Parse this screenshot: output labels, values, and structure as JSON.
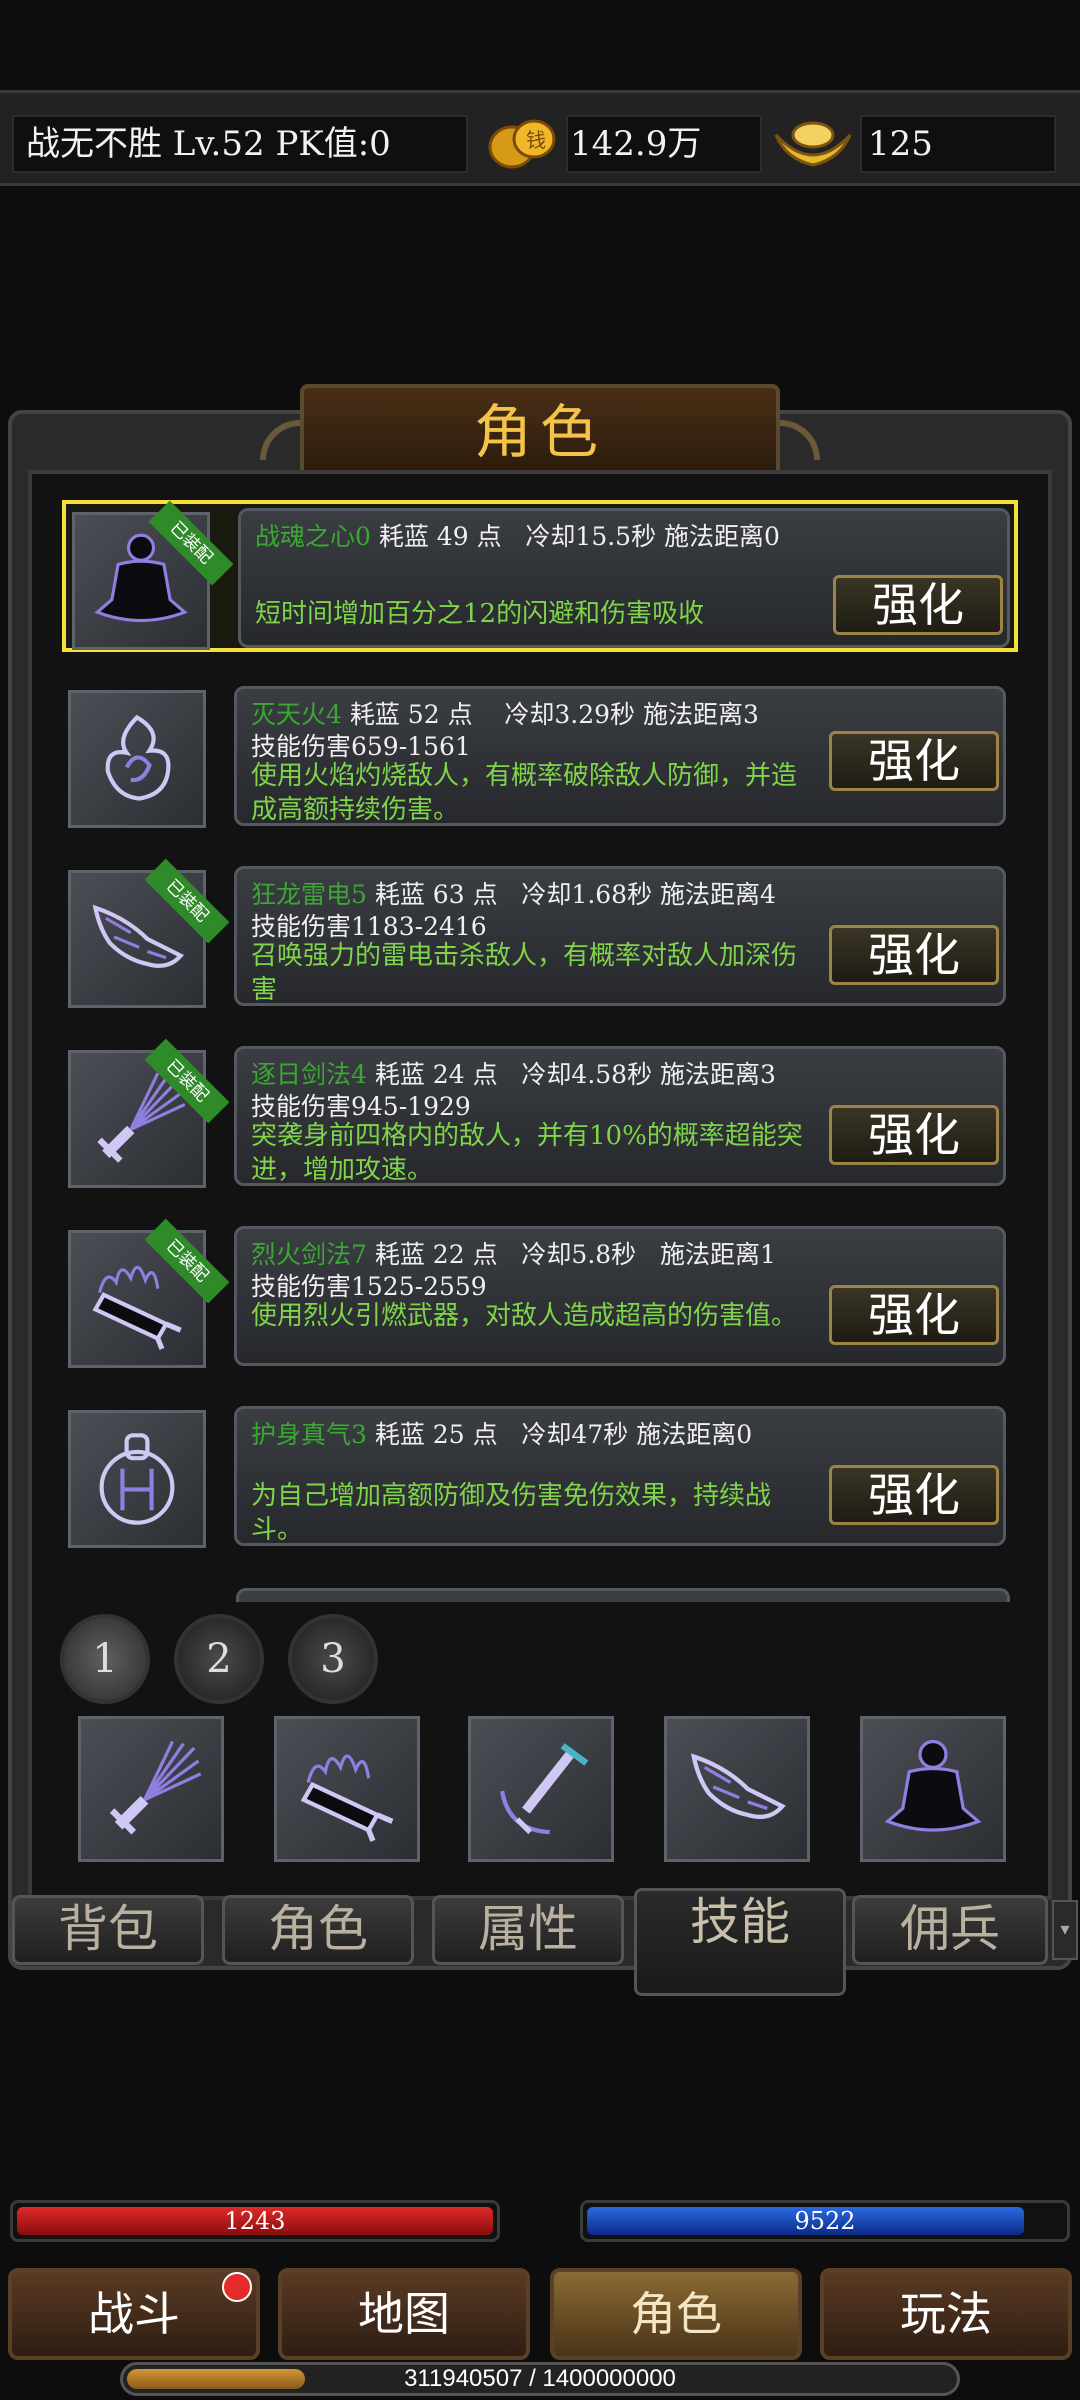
{
  "header": {
    "player": "战无不胜  Lv.52  PK值:0",
    "gold": "142.9万",
    "ingot": "125"
  },
  "panel_title": "角色",
  "skills": [
    {
      "name": "战魂之心0",
      "cost": "耗蓝 49 点",
      "cooldown": "冷却15.5秒",
      "range": "施法距离0",
      "damage": "",
      "desc": "短时间增加百分之12的闪避和伤害吸收",
      "equipped": "已装配",
      "enhance": "强化"
    },
    {
      "name": "灭天火4",
      "cost": "耗蓝 52 点",
      "cooldown": "冷却3.29秒",
      "range": "施法距离3",
      "damage": "技能伤害659-1561",
      "desc": "使用火焰灼烧敌人，有概率破除敌人防御，并造成高额持续伤害。",
      "equipped": "",
      "enhance": "强化"
    },
    {
      "name": "狂龙雷电5",
      "cost": "耗蓝 63 点",
      "cooldown": "冷却1.68秒",
      "range": "施法距离4",
      "damage": "技能伤害1183-2416",
      "desc": "召唤强力的雷电击杀敌人，有概率对敌人加深伤害",
      "equipped": "已装配",
      "enhance": "强化"
    },
    {
      "name": "逐日剑法4",
      "cost": "耗蓝 24 点",
      "cooldown": "冷却4.58秒",
      "range": "施法距离3",
      "damage": "技能伤害945-1929",
      "desc": "突袭身前四格内的敌人，并有10%的概率超能突进，增加攻速。",
      "equipped": "已装配",
      "enhance": "强化"
    },
    {
      "name": "烈火剑法7",
      "cost": "耗蓝 22 点",
      "cooldown": "冷却5.8秒",
      "range": "施法距离1",
      "damage": "技能伤害1525-2559",
      "desc": "使用烈火引燃武器，对敌人造成超高的伤害值。",
      "equipped": "已装配",
      "enhance": "强化"
    },
    {
      "name": "护身真气3",
      "cost": "耗蓝 25 点",
      "cooldown": "冷却47秒",
      "range": "施法距离0",
      "damage": "",
      "desc": "为自己增加高额防御及伤害免伤效果，持续战斗。",
      "equipped": "",
      "enhance": "强化"
    }
  ],
  "pages": [
    "1",
    "2",
    "3"
  ],
  "slots": [
    "sword-rain-icon",
    "flame-sword-icon",
    "anchor-sword-icon",
    "dragon-icon",
    "meditate-icon"
  ],
  "tabs": [
    "背包",
    "角色",
    "属性",
    "技能",
    "佣兵"
  ],
  "hp": {
    "value": "1243",
    "fill": 1.0
  },
  "mp": {
    "value": "9522",
    "fill": 0.92
  },
  "nav": [
    "战斗",
    "地图",
    "角色",
    "玩法"
  ],
  "xp": {
    "text": "311940507 / 1400000000",
    "fill": 0.2228
  },
  "colors": {
    "accent": "#f4c44a",
    "skill_name": "#3aa832",
    "desc": "#7fd44a",
    "hp": "#c41a1a",
    "mp": "#1a4fc4"
  }
}
